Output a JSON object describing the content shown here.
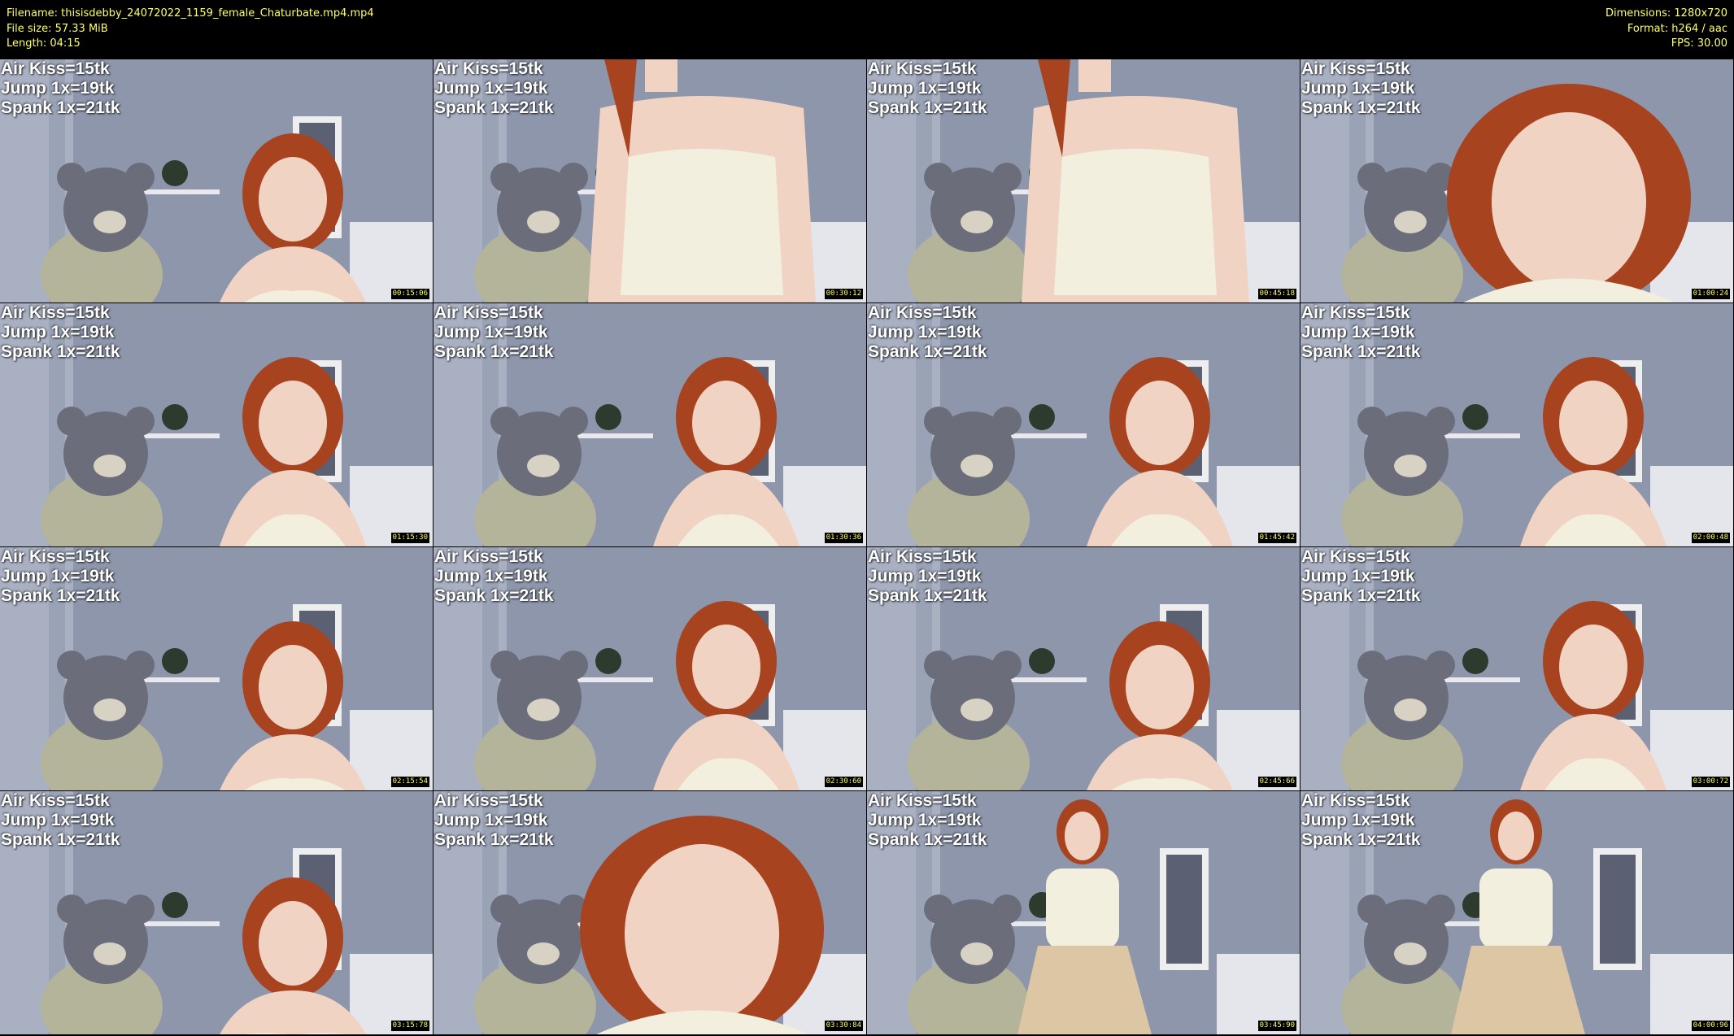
{
  "header": {
    "filename": "Filename: thisisdebby_24072022_1159_female_Chaturbate.mp4.mp4",
    "filesize": "File size: 57.33 MiB",
    "length": "Length: 04:15",
    "dimensions": "Dimensions: 1280x720",
    "format": "Format: h264 / aac",
    "fps": "FPS: 30.00"
  },
  "overlay": {
    "line1": "Air Kiss=15tk",
    "line2": "Jump 1x=19tk",
    "line3": "Spank 1x=21tk"
  },
  "colors": {
    "meta_text": "#ffff66",
    "background": "#000000",
    "overlay_text": "#ffffff"
  },
  "tiles": [
    {
      "timestamp": "00:15:06",
      "pose": "lean"
    },
    {
      "timestamp": "00:30:12",
      "pose": "closeup-torso"
    },
    {
      "timestamp": "00:45:18",
      "pose": "closeup-torso"
    },
    {
      "timestamp": "01:00:24",
      "pose": "closeup-head"
    },
    {
      "timestamp": "01:15:30",
      "pose": "seated"
    },
    {
      "timestamp": "01:30:36",
      "pose": "seated"
    },
    {
      "timestamp": "01:45:42",
      "pose": "seated"
    },
    {
      "timestamp": "02:00:48",
      "pose": "seated"
    },
    {
      "timestamp": "02:15:54",
      "pose": "lean"
    },
    {
      "timestamp": "02:30:60",
      "pose": "seated"
    },
    {
      "timestamp": "02:45:66",
      "pose": "lean"
    },
    {
      "timestamp": "03:00:72",
      "pose": "seated"
    },
    {
      "timestamp": "03:15:78",
      "pose": "seated-low"
    },
    {
      "timestamp": "03:30:84",
      "pose": "closeup-head"
    },
    {
      "timestamp": "03:45:90",
      "pose": "standing"
    },
    {
      "timestamp": "04:00:96",
      "pose": "standing"
    }
  ]
}
